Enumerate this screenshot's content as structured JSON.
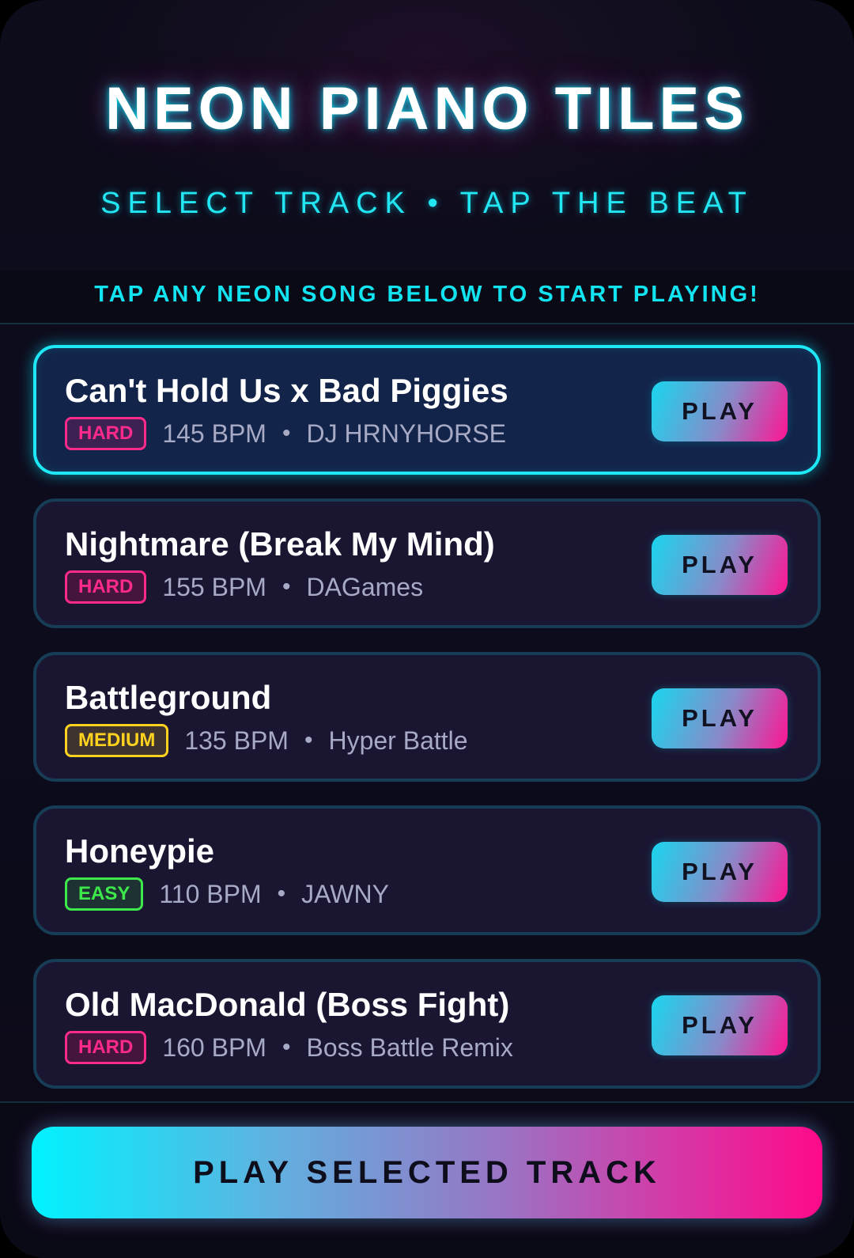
{
  "header": {
    "title": "NEON PIANO TILES",
    "subtitle": "SELECT TRACK • TAP THE BEAT"
  },
  "hint": "TAP ANY NEON SONG BELOW TO START PLAYING!",
  "tracks": [
    {
      "title": "Can't Hold Us x Bad Piggies",
      "difficulty": "HARD",
      "bpm": "145 BPM",
      "separator": "•",
      "artist": "DJ HRNYHORSE",
      "play_label": "PLAY",
      "selected": true
    },
    {
      "title": "Nightmare (Break My Mind)",
      "difficulty": "HARD",
      "bpm": "155 BPM",
      "separator": "•",
      "artist": "DAGames",
      "play_label": "PLAY",
      "selected": false
    },
    {
      "title": "Battleground",
      "difficulty": "MEDIUM",
      "bpm": "135 BPM",
      "separator": "•",
      "artist": "Hyper Battle",
      "play_label": "PLAY",
      "selected": false
    },
    {
      "title": "Honeypie",
      "difficulty": "EASY",
      "bpm": "110 BPM",
      "separator": "•",
      "artist": "JAWNY",
      "play_label": "PLAY",
      "selected": false
    },
    {
      "title": "Old MacDonald (Boss Fight)",
      "difficulty": "HARD",
      "bpm": "160 BPM",
      "separator": "•",
      "artist": "Boss Battle Remix",
      "play_label": "PLAY",
      "selected": false
    }
  ],
  "footer": {
    "play_selected_label": "PLAY SELECTED TRACK"
  },
  "colors": {
    "accent_cyan": "#1ee8f5",
    "accent_pink": "#ff1493",
    "hard": "#ff2a8c",
    "medium": "#ffd21f",
    "easy": "#3ce84a"
  }
}
